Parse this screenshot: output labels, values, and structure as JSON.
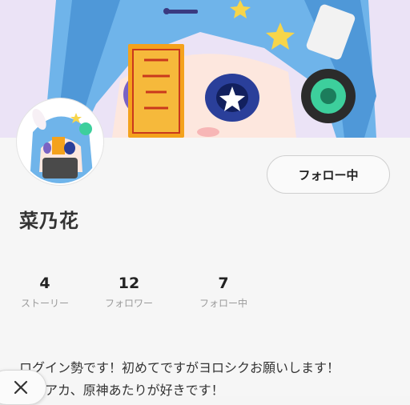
{
  "profile": {
    "display_name": "菜乃花",
    "follow_button_label": "フォロー中",
    "stats": [
      {
        "value": "4",
        "label": "ストーリー"
      },
      {
        "value": "12",
        "label": "フォロワー"
      },
      {
        "value": "7",
        "label": "フォロー中"
      }
    ],
    "bio_lines": [
      "ログイン勢です！初めてですがヨロシクお願いします！",
      "アカ、原神あたりが好きです！"
    ]
  },
  "icons": {
    "close": "close-icon",
    "header": "header-image",
    "avatar": "avatar-image"
  },
  "colors": {
    "banner_bg": "#e9e1f5",
    "hair": "#5aa9e6",
    "page_bg": "#f5f5f5"
  }
}
